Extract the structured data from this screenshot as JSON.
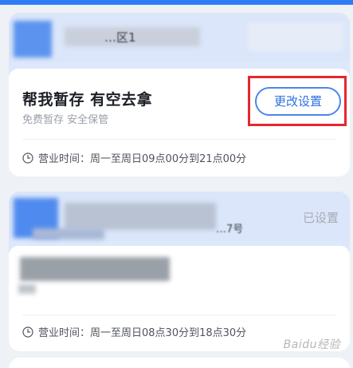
{
  "stations": [
    {
      "address_line": "…区1",
      "title": "帮我暂存 有空去拿",
      "subtitle": "免费暂存 安全保管",
      "action_label": "更改设置",
      "hours": "营业时间：周一至周日09点00分到21点00分"
    },
    {
      "address_line": "…7号",
      "status": "已设置",
      "hours": "营业时间：周一至周日08点30分到18点30分"
    }
  ],
  "watermark": "Baidu经验",
  "colors": {
    "accent_blue": "#2f7cf6",
    "button_border": "#4a86ee",
    "highlight_red": "#e8262d",
    "card_band": "#dbe6fa"
  },
  "icons": {
    "clock": "clock-icon"
  }
}
